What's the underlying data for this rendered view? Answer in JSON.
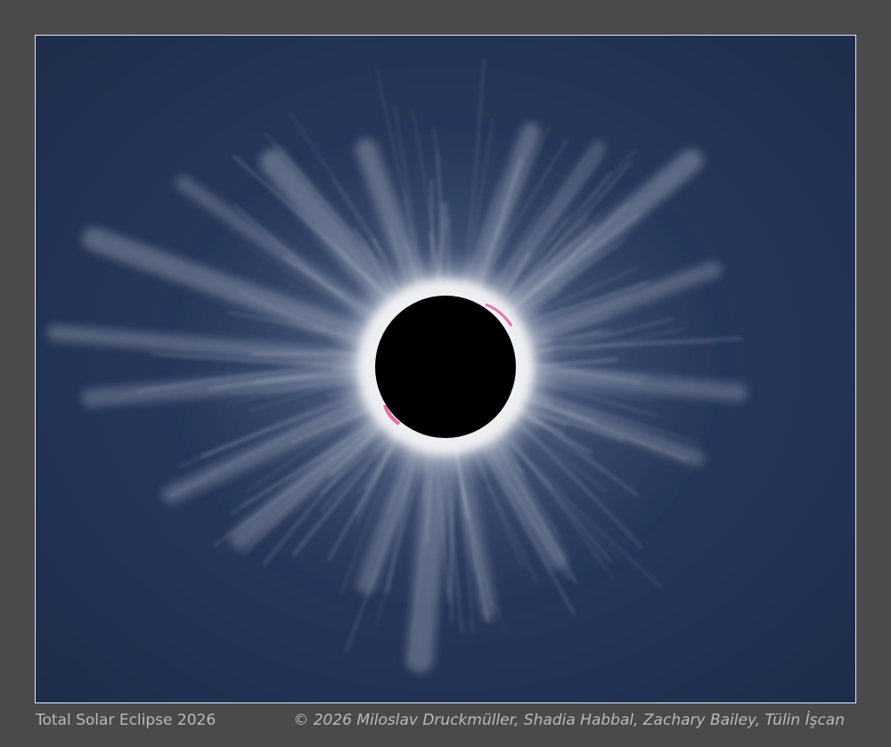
{
  "photo": {
    "subject": "total solar eclipse corona",
    "sky_color": "#263658",
    "moon_color": "#000000",
    "corona_color": "#ffffff",
    "prominence_color": "#e0609a"
  },
  "caption": {
    "title": "Total Solar Eclipse 2026",
    "credit": "© 2026 Miloslav Druckmüller, Shadia Habbal, Zachary Bailey, Tülin İşcan"
  }
}
